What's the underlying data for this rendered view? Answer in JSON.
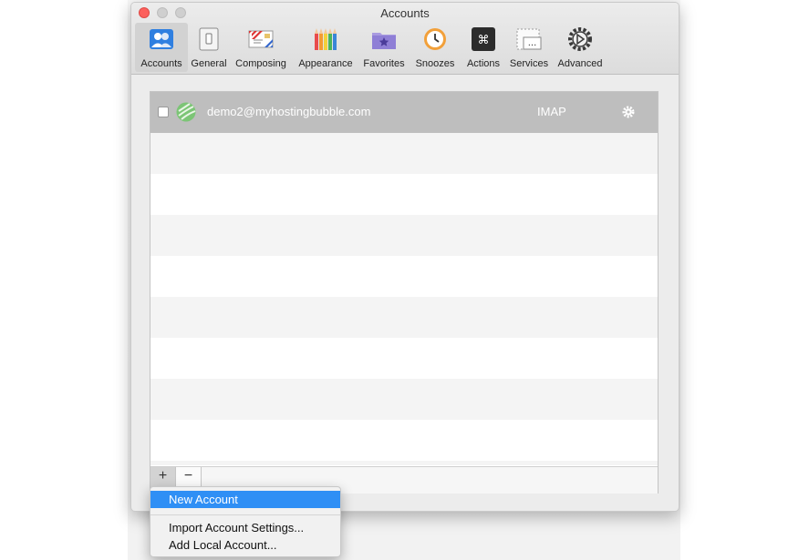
{
  "window": {
    "title": "Accounts"
  },
  "toolbar": {
    "items": [
      {
        "label": "Accounts",
        "icon": "people-icon"
      },
      {
        "label": "General",
        "icon": "switch-icon"
      },
      {
        "label": "Composing",
        "icon": "envelope-icon"
      },
      {
        "label": "Appearance",
        "icon": "pencils-icon"
      },
      {
        "label": "Favorites",
        "icon": "folder-star-icon"
      },
      {
        "label": "Snoozes",
        "icon": "clock-icon"
      },
      {
        "label": "Actions",
        "icon": "command-key-icon"
      },
      {
        "label": "Services",
        "icon": "ellipsis-box-icon"
      },
      {
        "label": "Advanced",
        "icon": "gear-icon"
      }
    ],
    "active": "Accounts"
  },
  "accounts": [
    {
      "email": "demo2@myhostingbubble.com",
      "type": "IMAP",
      "enabled": false
    }
  ],
  "controls": {
    "add": "+",
    "remove": "−"
  },
  "menu": {
    "items": [
      {
        "label": "New Account",
        "highlighted": true
      },
      {
        "label": "Import Account Settings..."
      },
      {
        "label": "Add Local Account..."
      }
    ]
  },
  "colors": {
    "highlight": "#2f8ff5",
    "selected_row": "#bebebe"
  }
}
